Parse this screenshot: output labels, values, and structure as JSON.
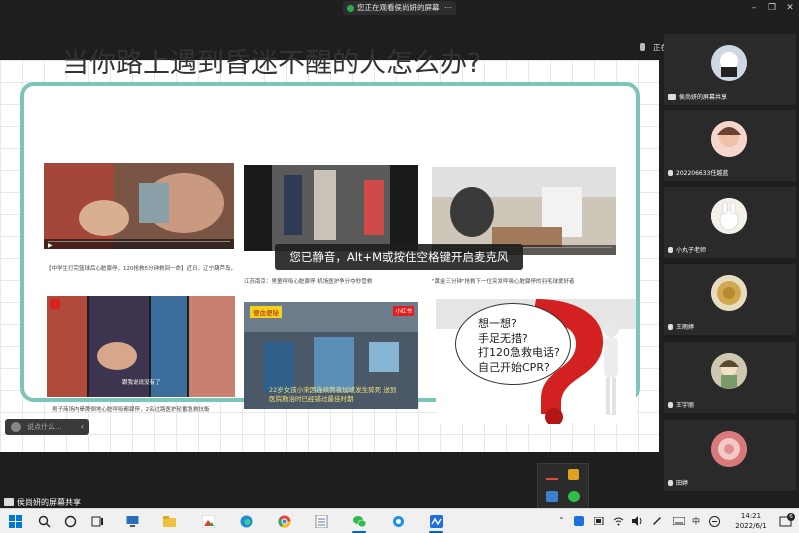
{
  "meeting": {
    "share_banner": "您正在观看侯尚妍的屏幕",
    "speaking_label": "正在讲话:",
    "sharer_bar": "侯尚妍的屏幕共享"
  },
  "slide": {
    "title": "当你路上遇到昏迷不醒的人怎么办?",
    "captions": [
      "【中学生打完篮球后心脏骤停，120抢救5分钟救回一命】近日，辽宁葫芦岛，一名16岁中学生打完篮球后突然晕倒，老师进行心肺复苏后...",
      "江苏南京：男童呼吸心脏骤停 机场医护争分夺秒营救",
      "\"黄金三分钟\"抢救下一位突发呼吸心脏骤停的羽毛球爱好者",
      "男子商场内晕厥倒地心脏呼吸都骤停，2名过路医护轮番急救抗衡",
      "22岁女孩小宋因连续熬夜加班发生猝死 送到医院救治时已经错过最佳时期"
    ],
    "thumb_overlays": {
      "hospital_sign": "便血便秘",
      "corner_tag": "小红书",
      "chat_caption": "跟我说说没有了"
    },
    "bubble_lines": [
      "想一想?",
      "手足无措?",
      "打120急救电话?",
      "自己开始CPR?"
    ]
  },
  "mute_toast": "您已静音，Alt+M或按住空格键开启麦克风",
  "chat_input": {
    "placeholder": "说点什么..."
  },
  "participants": [
    {
      "name": "侯尚妍的屏幕共享",
      "type": "screen",
      "avatar_color": "#3a6ea8"
    },
    {
      "name": "202206633任越蓝",
      "type": "mic",
      "avatar_color": "#e6b8b0"
    },
    {
      "name": "小丸子老师",
      "type": "mic",
      "avatar_color": "#f3eee8"
    },
    {
      "name": "王雨婷",
      "type": "mic",
      "avatar_color": "#d9c088"
    },
    {
      "name": "王宇丽",
      "type": "mic",
      "avatar_color": "#d7cfb8"
    },
    {
      "name": "田婷",
      "type": "mic",
      "avatar_color": "#c96262"
    }
  ],
  "taskbar": {
    "time": "14:21",
    "date": "2022/6/1",
    "ime": "中",
    "notification_count": "6"
  },
  "colors": {
    "frame_border": "#7cc6b7",
    "toast_bg": "#1e1e1e",
    "taskbar_bg": "#f0f0f0",
    "accent": "#0067c0"
  }
}
